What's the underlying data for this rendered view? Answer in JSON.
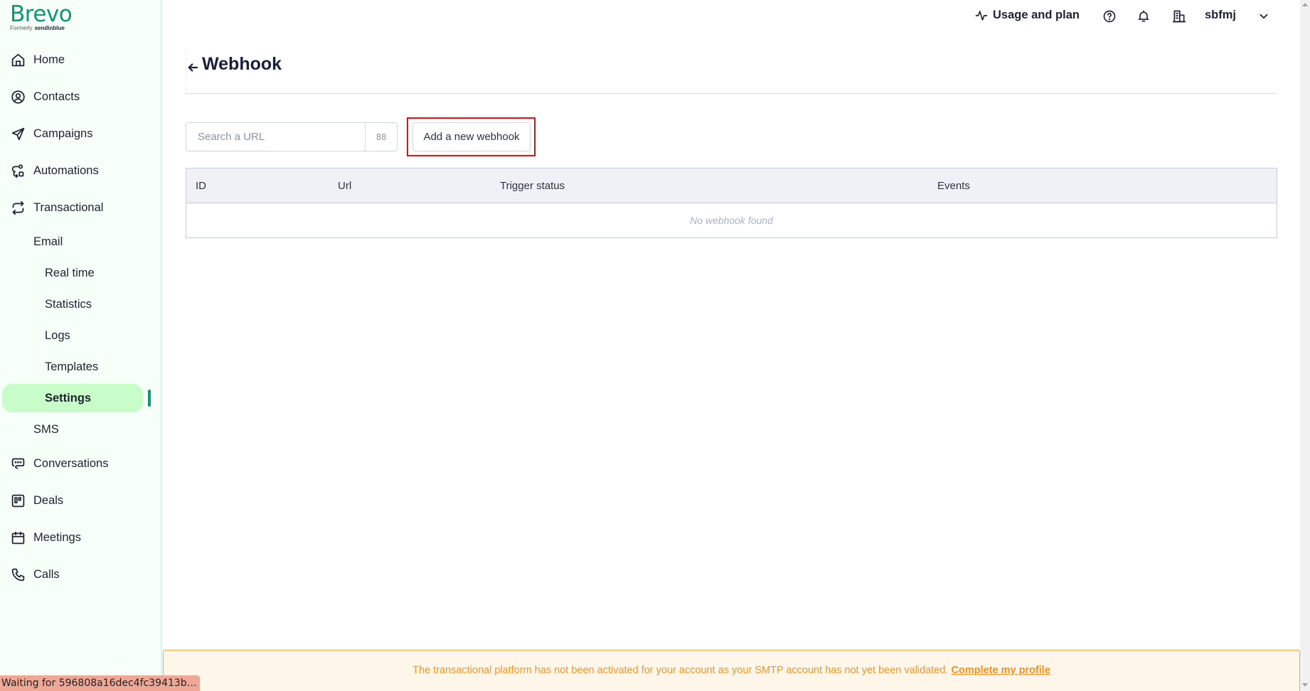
{
  "brand": {
    "name": "Brevo",
    "formerly_label": "Formerly",
    "formerly_brand": "sendinblue",
    "accent": "#0b996e"
  },
  "sidebar": {
    "items": [
      {
        "label": "Home",
        "icon": "home-icon"
      },
      {
        "label": "Contacts",
        "icon": "contacts-icon"
      },
      {
        "label": "Campaigns",
        "icon": "send-icon"
      },
      {
        "label": "Automations",
        "icon": "automation-icon"
      },
      {
        "label": "Transactional",
        "icon": "repeat-icon"
      },
      {
        "label": "Email"
      },
      {
        "label": "Real time"
      },
      {
        "label": "Statistics"
      },
      {
        "label": "Logs"
      },
      {
        "label": "Templates"
      },
      {
        "label": "Settings",
        "active": true
      },
      {
        "label": "SMS"
      },
      {
        "label": "Conversations",
        "icon": "chat-icon"
      },
      {
        "label": "Deals",
        "icon": "kanban-icon"
      },
      {
        "label": "Meetings",
        "icon": "calendar-icon"
      },
      {
        "label": "Calls",
        "icon": "phone-icon"
      }
    ],
    "active_color": "#c8fcc8"
  },
  "header": {
    "usage_label": "Usage and plan",
    "account_name": "sbfmj",
    "icons": [
      "activity-icon",
      "help-icon",
      "bell-icon",
      "building-icon",
      "chevron-down-icon"
    ]
  },
  "page": {
    "title": "Webhook",
    "search": {
      "placeholder": "Search a URL",
      "value": "",
      "grid_glyph": "88"
    },
    "add_button_label": "Add a new webhook",
    "table": {
      "columns": [
        "ID",
        "Url",
        "Trigger status",
        "Events"
      ],
      "rows": [],
      "empty_message": "No webhook found"
    }
  },
  "banner": {
    "message": "The transactional platform has not been activated for your account as your SMTP account has not yet been validated.",
    "link_label": "Complete my profile",
    "color": "#f0962a"
  },
  "statusbar": {
    "text": "Waiting for 596808a16dec4fc39413b…"
  }
}
